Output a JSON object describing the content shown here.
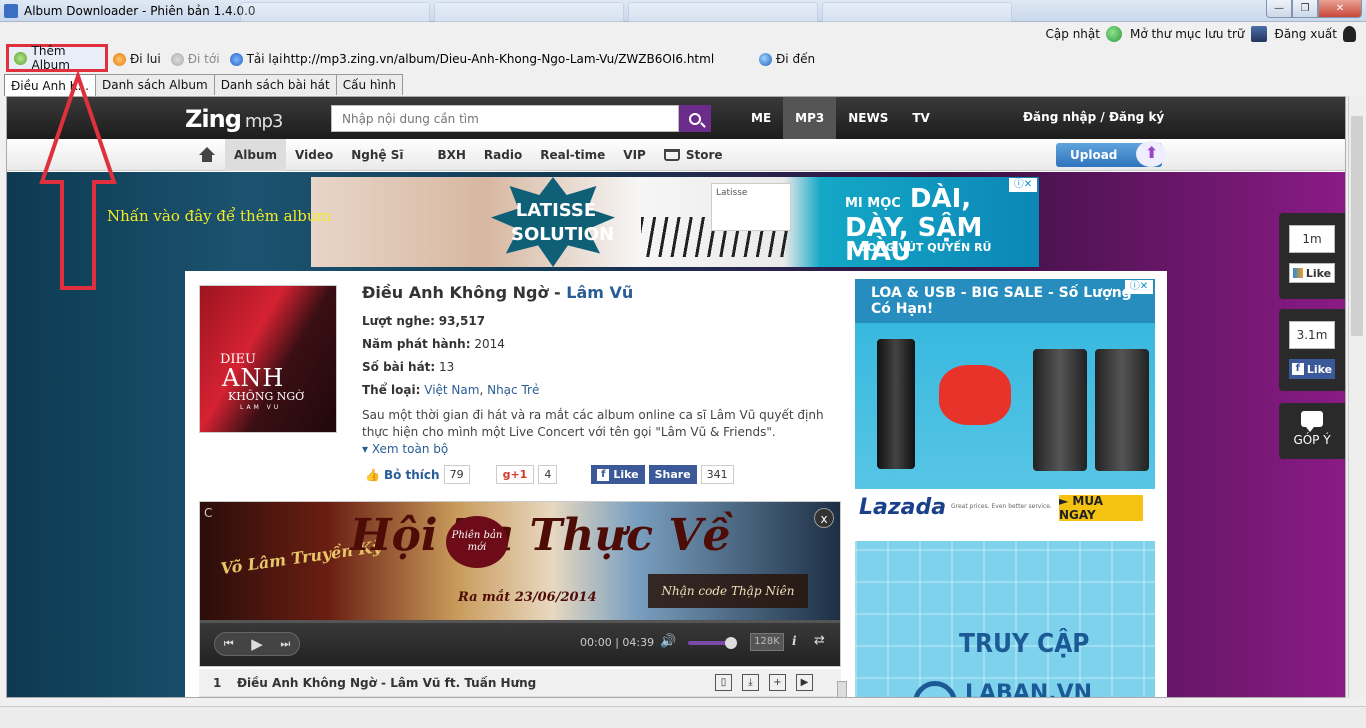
{
  "window": {
    "title": "Album Downloader - Phiên bản 1.4.0.0",
    "min": "—",
    "max": "❐",
    "close": "✕"
  },
  "topmenu": {
    "update": "Cập nhật",
    "open_folder": "Mở thư mục lưu trữ",
    "logout": "Đăng xuất"
  },
  "toolbar": {
    "add_album": "Thêm Album",
    "back": "Đi lui",
    "forward": "Đi tới",
    "reload": "Tải lại",
    "url": "http://mp3.zing.vn/album/Dieu-Anh-Khong-Ngo-Lam-Vu/ZWZB6OI6.html",
    "go": "Đi đến"
  },
  "tabs": [
    {
      "label": "Điều Anh K..."
    },
    {
      "label": "Danh sách Album"
    },
    {
      "label": "Danh sách bài hát"
    },
    {
      "label": "Cấu hình"
    }
  ],
  "annotation": {
    "text": "Nhấn vào đây để thêm album",
    "color": "#f4ea26",
    "arrow_color": "#e0303d"
  },
  "zing": {
    "logo_main": "Zing",
    "logo_sub": "mp3",
    "search_placeholder": "Nhập nội dung cần tìm",
    "nav_top": [
      "ME",
      "MP3",
      "NEWS",
      "TV"
    ],
    "login": "Đăng nhập / Đăng ký",
    "menu": [
      "Album",
      "Video",
      "Nghệ Sĩ",
      "BXH",
      "Radio",
      "Real-time",
      "VIP",
      "Store"
    ],
    "upload": "Upload",
    "accent": "#6c2c8c"
  },
  "banner": {
    "left_text": "LATISSE SOLUTION",
    "right_text_1": "MI MỌC",
    "right_text_2": "DÀI, DÀY, SẬM MÀU",
    "right_text_3": "CONG VÚT QUYẾN RŨ",
    "product_label": "Latisse"
  },
  "album": {
    "title": "Điều Anh Không Ngờ",
    "separator": " - ",
    "artist": "Lâm Vũ",
    "cover_line1": "DIEU",
    "cover_line2": "ANH",
    "cover_line3": "KHÔNG NGỜ",
    "cover_line4": "LAM VU",
    "views_label": "Lượt nghe:",
    "views": "93,517",
    "year_label": "Năm phát hành:",
    "year": "2014",
    "tracks_label": "Số bài hát:",
    "tracks": "13",
    "genre_label": "Thể loại:",
    "genre_1": "Việt Nam",
    "genre_sep": ", ",
    "genre_2": "Nhạc Trẻ",
    "description": "Sau một thời gian đi hát và ra mắt các album online ca sĩ Lâm Vũ quyết định thực hiện cho mình một Live Concert với tên gọi \"Lâm Vũ & Friends\".",
    "more": "Xem toàn bộ"
  },
  "social": {
    "like_label": "Bỏ thích",
    "like_count": "79",
    "gplus_label": "g+1",
    "gplus_count": "4",
    "fb_like": "Like",
    "fb_share": "Share",
    "fb_count": "341"
  },
  "player": {
    "art_title": "Hội Tạ Thực Về",
    "art_badge": "Phiên bản mới",
    "art_date": "Ra mắt 23/06/2014",
    "art_cta": "Nhận code Thập Niên",
    "art_logo": "Võ Lâm Truyền Kỳ",
    "close": "x",
    "cmark": "C",
    "time_current": "00:00",
    "time_total": "04:39",
    "quality": "128K",
    "volume_level": 0.85,
    "progress": 0
  },
  "track": {
    "number": "1",
    "title": "Điều Anh Không Ngờ - Lâm Vũ ft. Tuấn Hưng"
  },
  "ad_right1": {
    "header": "LOA & USB - BIG SALE - Số Lượng Có Hạn!",
    "brand": "Lazada",
    "tagline": "Great prices. Even better service.",
    "cta": "► MUA NGAY"
  },
  "ad_right2": {
    "line1": "TRUY CẬP",
    "line2": "LABAN.VN"
  },
  "sidebar": {
    "zing_count": "1m",
    "zing_like": "Like",
    "fb_count": "3.1m",
    "fb_like": "Like",
    "feedback": "GÓP Ý"
  }
}
